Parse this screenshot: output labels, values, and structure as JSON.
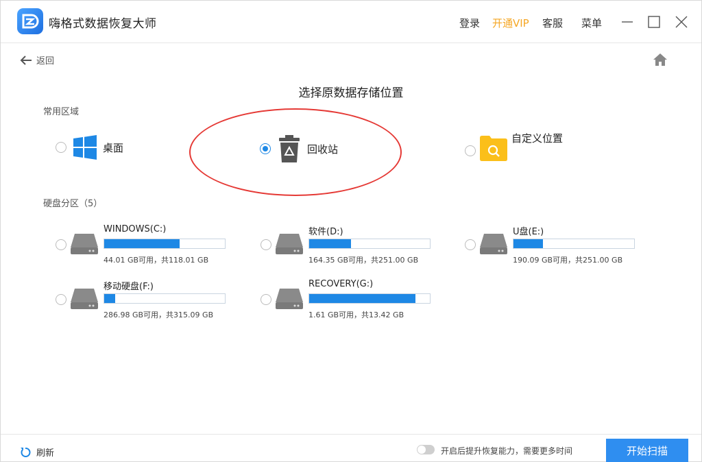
{
  "app": {
    "title": "嗨格式数据恢复大师"
  },
  "header": {
    "login": "登录",
    "vip": "开通VIP",
    "service": "客服",
    "menu": "菜单"
  },
  "nav": {
    "back_label": "返回"
  },
  "page": {
    "title": "选择原数据存储位置"
  },
  "common_area": {
    "label": "常用区域",
    "options": [
      {
        "label": "桌面",
        "icon": "windows-icon",
        "selected": false
      },
      {
        "label": "回收站",
        "icon": "recycle-bin-icon",
        "selected": true
      },
      {
        "label": "自定义位置",
        "icon": "folder-search-icon",
        "selected": false
      }
    ]
  },
  "disks": {
    "label": "硬盘分区（5）",
    "items": [
      {
        "name": "WINDOWS(C:)",
        "info": "44.01 GB可用，共118.01 GB",
        "used_fraction": 0.627
      },
      {
        "name": "软件(D:)",
        "info": "164.35 GB可用，共251.00 GB",
        "used_fraction": 0.345
      },
      {
        "name": "U盘(E:)",
        "info": "190.09 GB可用，共251.00 GB",
        "used_fraction": 0.243
      },
      {
        "name": "移动硬盘(F:)",
        "info": "286.98 GB可用，共315.09 GB",
        "used_fraction": 0.089
      },
      {
        "name": "RECOVERY(G:)",
        "info": "1.61 GB可用，共13.42 GB",
        "used_fraction": 0.88
      }
    ]
  },
  "footer": {
    "refresh_label": "刷新",
    "toggle_label": "开启后提升恢复能力，需要更多时间",
    "toggle_on": false,
    "start_label": "开始扫描"
  },
  "colors": {
    "accent": "#1e88e5",
    "vip": "#f5a623",
    "annotation": "#e53935",
    "button": "#2f8ef0"
  }
}
